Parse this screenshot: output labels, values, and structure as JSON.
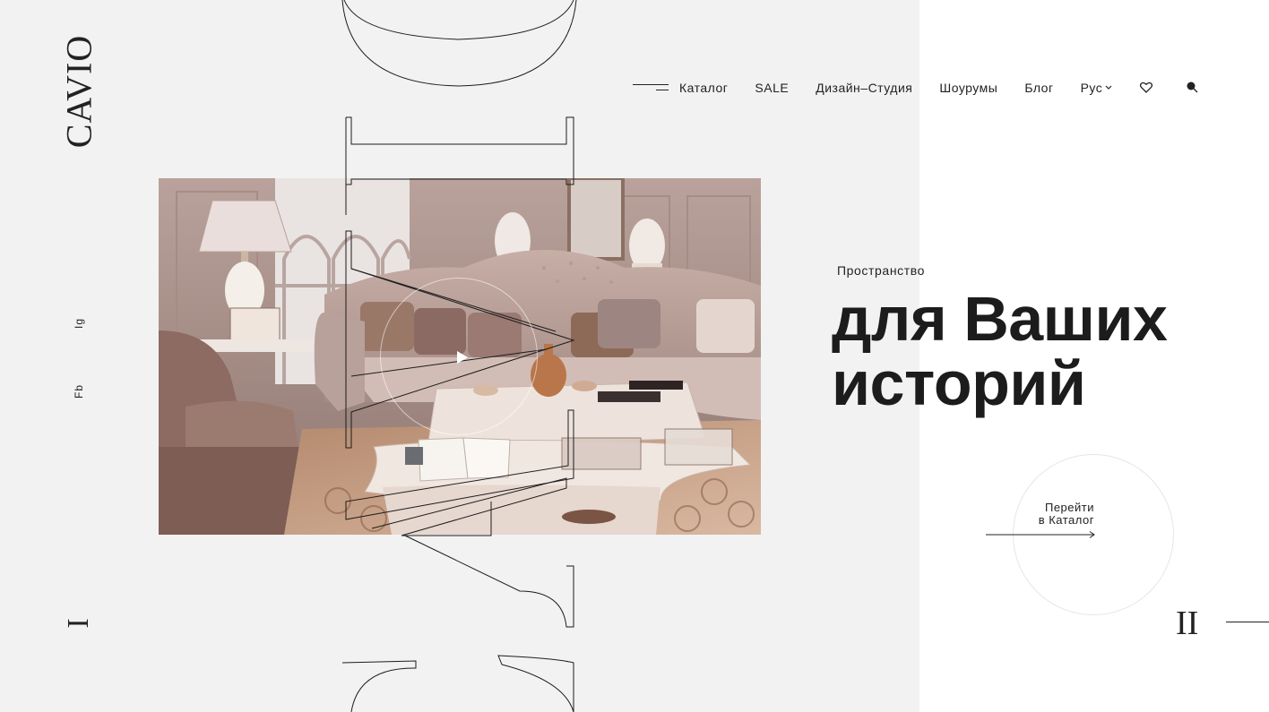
{
  "brand": {
    "logo_text": "CAVIO"
  },
  "nav": {
    "menu_label": "Каталог",
    "items": [
      "SALE",
      "Дизайн–Студия",
      "Шоурумы",
      "Блог"
    ],
    "language": "Рус",
    "icons": [
      "burger-menu-icon",
      "chevron-down-icon",
      "heart-icon",
      "search-icon"
    ]
  },
  "social": {
    "instagram": "Ig",
    "facebook": "Fb"
  },
  "hero": {
    "subtitle": "Пространство",
    "headline_line1": "для Ваших",
    "headline_line2": "историй",
    "cta_line1": "Перейти",
    "cta_line2": "в Каталог",
    "play_icon": "play-icon"
  },
  "slider": {
    "current_marker": "I",
    "next_marker": "II"
  },
  "colors": {
    "left_panel": "#f2f2f2",
    "text": "#1c1c1c",
    "background": "#ffffff"
  }
}
